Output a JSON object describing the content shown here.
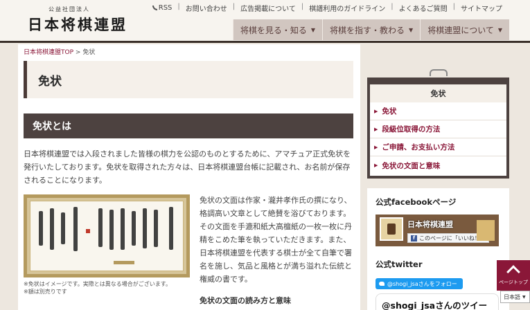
{
  "header": {
    "logo_sub": "公益社団法人",
    "logo_main": "日本将棋連盟",
    "toplinks": [
      "RSS",
      "お問い合わせ",
      "広告掲載について",
      "棋譜利用のガイドライン",
      "よくあるご質問",
      "サイトマップ"
    ],
    "nav": [
      "将棋を見る・知る",
      "将棋を指す・教わる",
      "将棋連盟について"
    ]
  },
  "breadcrumb": {
    "home": "日本将棋連盟TOP",
    "separator": ">",
    "current": "免状"
  },
  "page_title": "免状",
  "section_heading": "免状とは",
  "intro_text": "日本将棋連盟では入段されました皆様の棋力を公認のものとするために、アマチュア正式免状を発行いたしております。免状を取得された方々は、日本将棋連盟台帳に記載され、お名前が保存されることになります。",
  "photo_caption_1": "※免状はイメージです。実際とは異なる場合がございます。",
  "photo_caption_2": "※額は別売りです",
  "side_text": "免状の文面は作家・瀧井孝作氏の撰になり、格調高い文章として絶賛を浴びております。その文面を手漉和紙大高檀紙の一枚一枚に丹精をこめた筆を執っていただきます。また、日本将棋連盟を代表する棋士が全て自筆で署名を施し、気品と風格とが満ち溢れた伝統と権威の書です。",
  "sub_heading": "免状の文面の読み方と意味",
  "sidebar": {
    "menu_title": "免状",
    "items": [
      "免状",
      "段級位取得の方法",
      "ご申請、お支払い方法",
      "免状の文面と意味"
    ],
    "fb_title": "公式facebookページ",
    "fb_name": "日本将棋連盟",
    "fb_like": "このページに「いいね！」",
    "tw_title": "公式twitter",
    "tw_follow": "@shogi_jsaさんをフォロー",
    "tw_embed": "@shogi_jsaさんのツイー"
  },
  "pagetop_label": "ページトップ",
  "lang_label": "日本語",
  "colors": {
    "accent": "#8a1738",
    "dark": "#4d4240",
    "nav": "#d1c6c0"
  }
}
